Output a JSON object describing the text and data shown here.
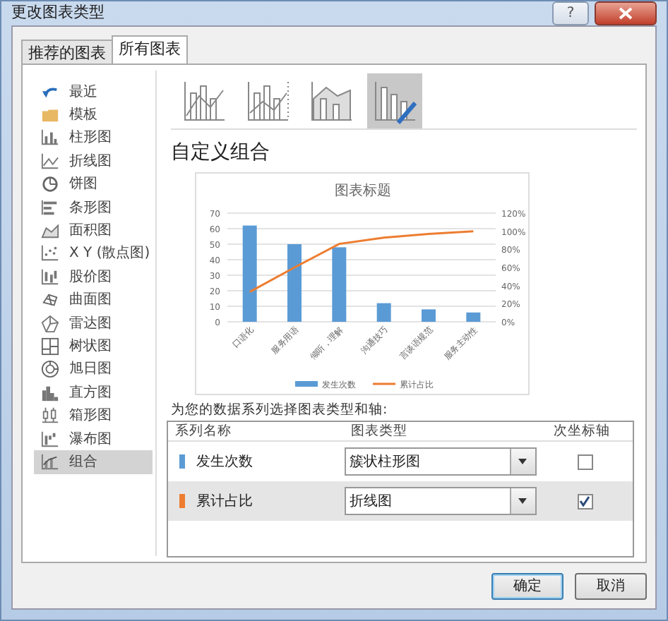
{
  "window": {
    "title": "更改图表类型",
    "help": "?"
  },
  "tabs": [
    {
      "label": "推荐的图表",
      "selected": false
    },
    {
      "label": "所有图表",
      "selected": true
    }
  ],
  "sidebar": {
    "items": [
      {
        "label": "最近",
        "selected": false
      },
      {
        "label": "模板",
        "selected": false
      },
      {
        "label": "柱形图",
        "selected": false
      },
      {
        "label": "折线图",
        "selected": false
      },
      {
        "label": "饼图",
        "selected": false
      },
      {
        "label": "条形图",
        "selected": false
      },
      {
        "label": "面积图",
        "selected": false
      },
      {
        "label": "X Y (散点图)",
        "selected": false
      },
      {
        "label": "股价图",
        "selected": false
      },
      {
        "label": "曲面图",
        "selected": false
      },
      {
        "label": "雷达图",
        "selected": false
      },
      {
        "label": "树状图",
        "selected": false
      },
      {
        "label": "旭日图",
        "selected": false
      },
      {
        "label": "直方图",
        "selected": false
      },
      {
        "label": "箱形图",
        "selected": false
      },
      {
        "label": "瀑布图",
        "selected": false
      },
      {
        "label": "组合",
        "selected": true
      }
    ]
  },
  "subtypes": [
    {
      "selected": false
    },
    {
      "selected": false
    },
    {
      "selected": false
    },
    {
      "selected": true
    }
  ],
  "heading": "自定义组合",
  "chart": {
    "chart_data": {
      "type": "bar",
      "title": "图表标题",
      "categories": [
        "口语化",
        "服务用语",
        "倾听，理解",
        "沟通技巧",
        "言谈语规范",
        "服务主动性"
      ],
      "series": [
        {
          "name": "发生次数",
          "color": "#5b9bd5",
          "values": [
            62,
            50,
            48,
            12,
            8,
            6
          ]
        },
        {
          "name": "累计占比",
          "color": "#ed7d31",
          "type": "line",
          "axis": "y2",
          "values": [
            0.33,
            0.6,
            0.86,
            0.93,
            0.97,
            1.0
          ]
        }
      ],
      "grid": true,
      "legend": "bottom",
      "ylim": [
        0,
        70
      ],
      "yticks": [
        0,
        10,
        20,
        30,
        40,
        50,
        60,
        70
      ],
      "y2lim": [
        0,
        1.2
      ],
      "y2ticks": [
        {
          "value": 0,
          "label": "0%"
        },
        {
          "value": 0.2,
          "label": "20%"
        },
        {
          "value": 0.4,
          "label": "40%"
        },
        {
          "value": 0.6,
          "label": "60%"
        },
        {
          "value": 0.8,
          "label": "80%"
        },
        {
          "value": 1.0,
          "label": "100%"
        },
        {
          "value": 1.2,
          "label": "120%"
        }
      ]
    }
  },
  "series_prompt": "为您的数据系列选择图表类型和轴:",
  "series_table": {
    "columns": [
      "系列名称",
      "图表类型",
      "次坐标轴"
    ],
    "rows": [
      {
        "name": "发生次数",
        "color": "#5b9bd5",
        "chart_type": "簇状柱形图",
        "secondary_axis": false,
        "selected": false
      },
      {
        "name": "累计占比",
        "color": "#ed7d31",
        "chart_type": "折线图",
        "secondary_axis": true,
        "selected": true
      }
    ]
  },
  "buttons": [
    {
      "label": "确定",
      "kind": "primary"
    },
    {
      "label": "取消",
      "kind": "secondary"
    }
  ]
}
